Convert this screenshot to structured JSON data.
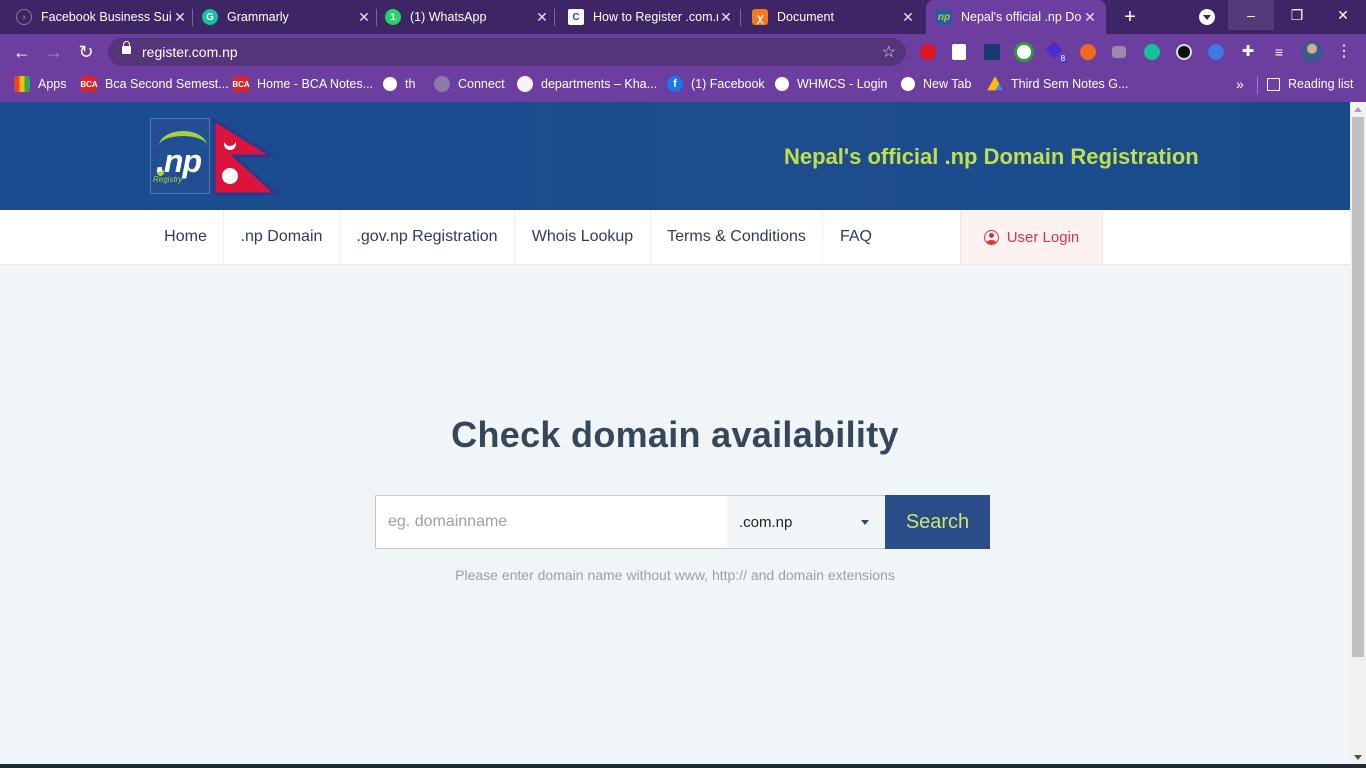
{
  "browser": {
    "tabs": [
      {
        "title": "Facebook Business Sui",
        "icon": "facebook-business-icon",
        "active": false
      },
      {
        "title": "Grammarly",
        "icon": "grammarly-icon",
        "active": false
      },
      {
        "title": "(1) WhatsApp",
        "icon": "whatsapp-icon",
        "active": false
      },
      {
        "title": "How to Register .com.n",
        "icon": "article-c-icon",
        "active": false
      },
      {
        "title": "Document",
        "icon": "xampp-icon",
        "active": false
      },
      {
        "title": "Nepal's official .np Dom",
        "icon": "np-registry-icon",
        "active": true
      }
    ],
    "new_tab": "+",
    "window_controls": {
      "minimize": "–",
      "restore": "❐",
      "close": "✕"
    },
    "address": "register.com.np",
    "nav": {
      "back": "←",
      "forward": "→",
      "reload": "↻"
    },
    "extensions": [
      "adblock-icon",
      "translate-icon",
      "j-icon",
      "download-manager-icon",
      "stack-icon",
      "fire-icon",
      "camera-icon",
      "grammarly-ext-icon",
      "cloud-icon",
      "back-arrow-icon",
      "puzzle-icon",
      "media-icon",
      "profile-avatar",
      "menu-dots-icon"
    ],
    "extension_badge": "8",
    "bookmarks": [
      {
        "label": "Apps",
        "icon": "apps-grid-icon"
      },
      {
        "label": "Bca Second Semest...",
        "icon": "bca-icon"
      },
      {
        "label": "Home - BCA Notes...",
        "icon": "bca-icon"
      },
      {
        "label": "th",
        "icon": "globe-icon"
      },
      {
        "label": "Connect",
        "icon": "gear-icon"
      },
      {
        "label": "departments – Kha...",
        "icon": "site-icon"
      },
      {
        "label": "(1) Facebook",
        "icon": "facebook-icon"
      },
      {
        "label": "WHMCS - Login",
        "icon": "globe-icon"
      },
      {
        "label": "New Tab",
        "icon": "globe-icon"
      },
      {
        "label": "Third Sem Notes G...",
        "icon": "drive-icon"
      }
    ],
    "bookmarks_overflow": "»",
    "reading_list": "Reading list"
  },
  "site": {
    "logo_text": ".np",
    "logo_sub": "Registry",
    "tagline": "Nepal's official .np Domain Registration",
    "nav": [
      {
        "label": "Home"
      },
      {
        "label": ".np Domain"
      },
      {
        "label": ".gov.np Registration"
      },
      {
        "label": "Whois Lookup"
      },
      {
        "label": "Terms & Conditions"
      },
      {
        "label": "FAQ"
      }
    ],
    "login": "User Login",
    "hero": {
      "title": "Check domain availability",
      "input_placeholder": "eg. domainname",
      "input_value": "",
      "extension_selected": ".com.np",
      "search_label": "Search",
      "hint": "Please enter domain name without www, http:// and domain extensions"
    }
  }
}
